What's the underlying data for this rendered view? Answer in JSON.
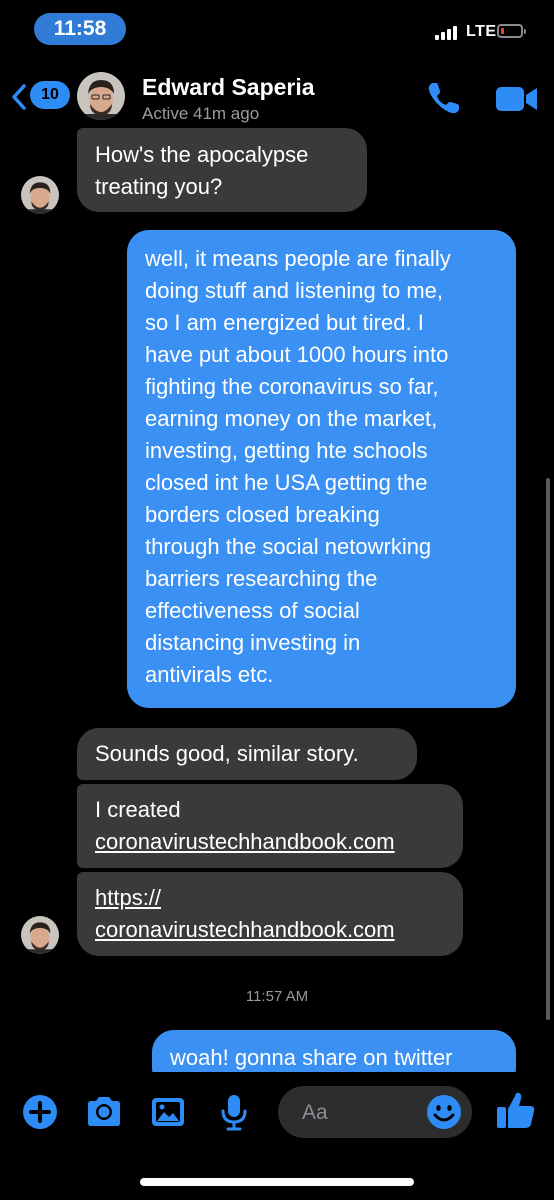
{
  "status_bar": {
    "time": "11:58",
    "network": "LTE"
  },
  "header": {
    "back_count": "10",
    "contact_name": "Edward Saperia",
    "contact_status": "Active 41m ago"
  },
  "messages": [
    {
      "direction": "in",
      "lines": [
        "How's the apocalypse",
        "treating you?"
      ]
    },
    {
      "direction": "out",
      "lines": [
        "well, it means people are finally",
        "doing stuff and listening to me,",
        "so I am energized but tired. I",
        "have put about 1000 hours into",
        "fighting the coronavirus so far,",
        "earning money on the market,",
        "investing, getting hte schools",
        "closed int he USA getting the",
        "borders closed breaking",
        "through the social netowrking",
        "barriers researching the",
        "effectiveness of social",
        "distancing investing in",
        "antivirals etc."
      ]
    },
    {
      "direction": "in",
      "lines": [
        "Sounds good, similar story."
      ]
    },
    {
      "direction": "in",
      "lines": [
        "I created",
        "coronavirustechhandbook.com"
      ]
    },
    {
      "direction": "in",
      "lines": [
        "https://",
        "coronavirustechhandbook.com"
      ]
    },
    {
      "direction": "out",
      "lines": [
        "woah! gonna share on twitter"
      ]
    }
  ],
  "timestamp": "11:57 AM",
  "composer": {
    "placeholder": "Aa",
    "icons": [
      "plus-icon",
      "camera-icon",
      "gallery-icon",
      "microphone-icon",
      "emoji-icon",
      "thumbs-up-icon"
    ]
  },
  "colors": {
    "accent": "#2e8cf6",
    "outgoing_bubble": "#3a90f3",
    "incoming_bubble": "#3a3a3c",
    "background": "#000000"
  }
}
